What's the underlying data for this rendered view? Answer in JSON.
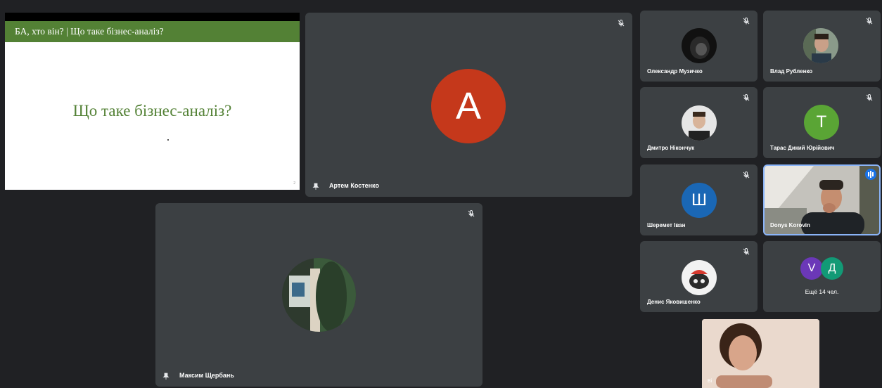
{
  "slide": {
    "header_title": "БА, хто він? | Що таке бізнес-аналіз?",
    "heading": "Що таке бізнес-аналіз?",
    "page_number": "2"
  },
  "main_tiles": [
    {
      "name": "Артем Костенко",
      "initial": "A",
      "avatar_color": "#c5381b"
    },
    {
      "name": "Максим Щербань"
    }
  ],
  "grid_tiles": [
    {
      "name": "Олександр Музичко"
    },
    {
      "name": "Влад Рубленко"
    },
    {
      "name": "Дмитро Ніконч​ук"
    },
    {
      "name": "Тарас Дикий Юрійович",
      "initial": "T",
      "avatar_color": "#5aa535"
    },
    {
      "name": "Шеремет Іван",
      "initial": "Ш",
      "avatar_color": "#1a67b5"
    },
    {
      "name": "Donys Korovin"
    },
    {
      "name": "Денис Яковишенко"
    }
  ],
  "more_tile": {
    "initial_1": "V",
    "color_1": "#6b38b8",
    "initial_2": "Д",
    "color_2": "#129a76",
    "label": "Ещё 14 чел."
  },
  "self_view": {
    "name_fragment": "Ві"
  },
  "colors": {
    "background": "#202124",
    "tile": "#3c4043",
    "active_speaker_border": "#8ab4f8"
  }
}
